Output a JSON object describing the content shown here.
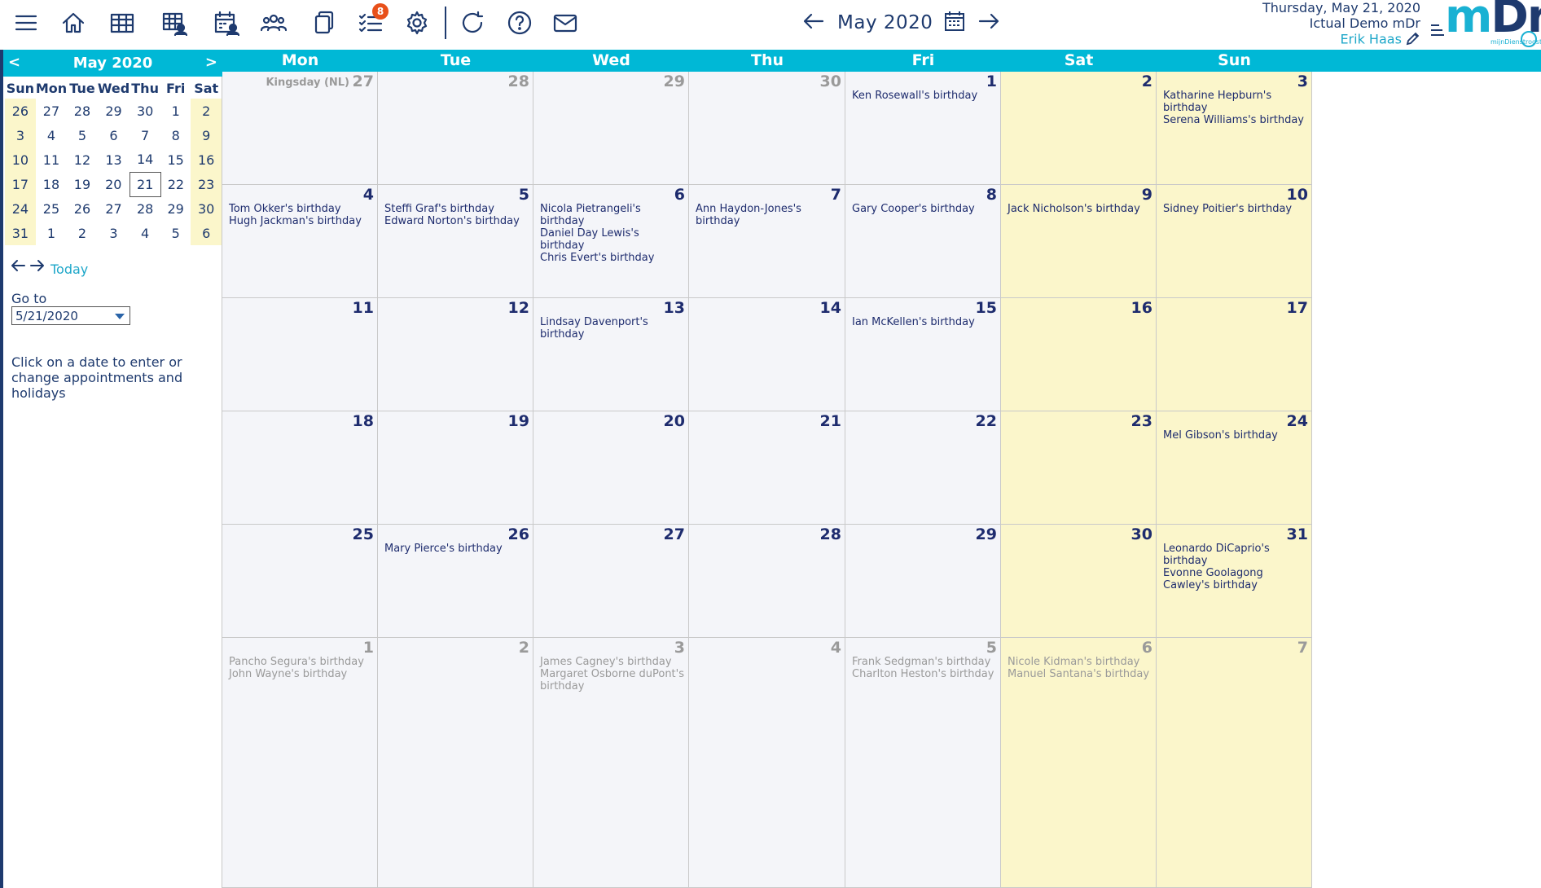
{
  "toolbar": {
    "icons": [
      "menu-icon",
      "home-icon",
      "grid-icon",
      "grid-user-icon",
      "calendar-user-icon",
      "team-icon",
      "copy-icon",
      "checklist-icon",
      "gear-icon",
      "refresh-icon",
      "help-icon",
      "mail-icon"
    ],
    "tasks_badge": "8"
  },
  "header": {
    "month_title": "May 2020"
  },
  "user": {
    "date": "Thursday, May 21, 2020",
    "company": "Ictual Demo mDr",
    "name": "Erik Haas"
  },
  "logo": {
    "m": "m",
    "dr": "Dr",
    "sub": "mijnDienstrooster"
  },
  "sidebar": {
    "mini_title": "May 2020",
    "prev": "<",
    "next": ">",
    "weekdays": [
      "Sun",
      "Mon",
      "Tue",
      "Wed",
      "Thu",
      "Fri",
      "Sat"
    ],
    "weeks": [
      [
        "26",
        "27",
        "28",
        "29",
        "30",
        "1",
        "2"
      ],
      [
        "3",
        "4",
        "5",
        "6",
        "7",
        "8",
        "9"
      ],
      [
        "10",
        "11",
        "12",
        "13",
        "14",
        "15",
        "16"
      ],
      [
        "17",
        "18",
        "19",
        "20",
        "21",
        "22",
        "23"
      ],
      [
        "24",
        "25",
        "26",
        "27",
        "28",
        "29",
        "30"
      ],
      [
        "31",
        "1",
        "2",
        "3",
        "4",
        "5",
        "6"
      ]
    ],
    "today_link": "Today",
    "goto_label": "Go to",
    "goto_value": "5/21/2020",
    "hint": "Click on a date to enter or change appointments and holidays"
  },
  "calendar": {
    "day_headers": [
      "Mon",
      "Tue",
      "Wed",
      "Thu",
      "Fri",
      "Sat",
      "Sun"
    ],
    "weeks": [
      [
        {
          "day": "27",
          "other": true,
          "holiday": "Kingsday (NL)",
          "events": []
        },
        {
          "day": "28",
          "other": true,
          "events": []
        },
        {
          "day": "29",
          "other": true,
          "events": []
        },
        {
          "day": "30",
          "other": true,
          "events": []
        },
        {
          "day": "1",
          "events": [
            "Ken Rosewall's birthday"
          ]
        },
        {
          "day": "2",
          "events": []
        },
        {
          "day": "3",
          "events": [
            "Katharine Hepburn's birthday",
            "Serena Williams's birthday"
          ]
        }
      ],
      [
        {
          "day": "4",
          "events": [
            "Tom Okker's birthday",
            "Hugh Jackman's birthday"
          ]
        },
        {
          "day": "5",
          "events": [
            "Steffi Graf's birthday",
            "Edward Norton's birthday"
          ]
        },
        {
          "day": "6",
          "events": [
            "Nicola Pietrangeli's birthday",
            "Daniel Day Lewis's birthday",
            "Chris Evert's birthday"
          ]
        },
        {
          "day": "7",
          "events": [
            "Ann Haydon-Jones's birthday"
          ]
        },
        {
          "day": "8",
          "events": [
            "Gary Cooper's birthday"
          ]
        },
        {
          "day": "9",
          "events": [
            "Jack Nicholson's birthday"
          ]
        },
        {
          "day": "10",
          "events": [
            "Sidney Poitier's birthday"
          ]
        }
      ],
      [
        {
          "day": "11",
          "events": []
        },
        {
          "day": "12",
          "events": []
        },
        {
          "day": "13",
          "events": [
            "Lindsay Davenport's birthday"
          ]
        },
        {
          "day": "14",
          "events": []
        },
        {
          "day": "15",
          "events": [
            "Ian McKellen's birthday"
          ]
        },
        {
          "day": "16",
          "events": []
        },
        {
          "day": "17",
          "events": []
        }
      ],
      [
        {
          "day": "18",
          "events": []
        },
        {
          "day": "19",
          "events": []
        },
        {
          "day": "20",
          "events": []
        },
        {
          "day": "21",
          "events": []
        },
        {
          "day": "22",
          "events": []
        },
        {
          "day": "23",
          "events": []
        },
        {
          "day": "24",
          "events": [
            "Mel Gibson's birthday"
          ]
        }
      ],
      [
        {
          "day": "25",
          "events": []
        },
        {
          "day": "26",
          "events": [
            "Mary Pierce's birthday"
          ]
        },
        {
          "day": "27",
          "events": []
        },
        {
          "day": "28",
          "events": []
        },
        {
          "day": "29",
          "events": []
        },
        {
          "day": "30",
          "events": []
        },
        {
          "day": "31",
          "events": [
            "Leonardo DiCaprio's birthday",
            "Evonne Goolagong Cawley's birthday"
          ]
        }
      ],
      [
        {
          "day": "1",
          "other": true,
          "events": [
            "Pancho Segura's birthday",
            "John Wayne's birthday"
          ]
        },
        {
          "day": "2",
          "other": true,
          "events": []
        },
        {
          "day": "3",
          "other": true,
          "events": [
            "James Cagney's birthday",
            "Margaret Osborne duPont's birthday"
          ]
        },
        {
          "day": "4",
          "other": true,
          "events": []
        },
        {
          "day": "5",
          "other": true,
          "events": [
            "Frank Sedgman's birthday",
            "Charlton Heston's birthday"
          ]
        },
        {
          "day": "6",
          "other": true,
          "events": [
            "Nicole Kidman's birthday",
            "Manuel Santana's birthday"
          ]
        },
        {
          "day": "7",
          "other": true,
          "events": []
        }
      ]
    ]
  },
  "colors": {
    "accent": "#00b8d6",
    "navy": "#1e3a6e",
    "weekend": "#fbf6cb",
    "weekday_cell": "#f4f5f9",
    "badge": "#e8501a"
  }
}
